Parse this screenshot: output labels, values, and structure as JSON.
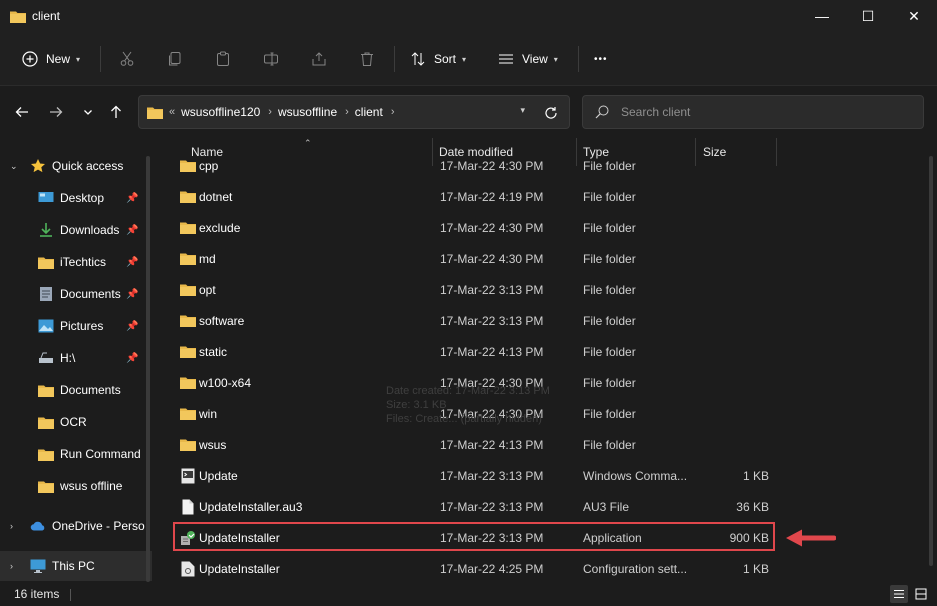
{
  "window": {
    "title": "client",
    "minimize_glyph": "—",
    "maximize_glyph": "☐",
    "close_glyph": "✕"
  },
  "toolbar": {
    "new_label": "New",
    "sort_label": "Sort",
    "view_label": "View",
    "more_glyph": "•••"
  },
  "address": {
    "overflow": "«",
    "crumbs": [
      "wsusoffline120",
      "wsusoffline",
      "client"
    ]
  },
  "search": {
    "placeholder": "Search client"
  },
  "sidebar": {
    "items": [
      {
        "label": "Quick access",
        "icon": "star-icon",
        "pinned": false
      },
      {
        "label": "Desktop",
        "icon": "desktop-icon",
        "pinned": true
      },
      {
        "label": "Downloads",
        "icon": "download-icon",
        "pinned": true
      },
      {
        "label": "iTechtics",
        "icon": "folder-icon",
        "pinned": true
      },
      {
        "label": "Documents",
        "icon": "document-icon",
        "pinned": true
      },
      {
        "label": "Pictures",
        "icon": "pictures-icon",
        "pinned": true
      },
      {
        "label": "H:\\",
        "icon": "drive-icon",
        "pinned": true
      },
      {
        "label": "Documents",
        "icon": "folder-icon",
        "pinned": false
      },
      {
        "label": "OCR",
        "icon": "folder-icon",
        "pinned": false
      },
      {
        "label": "Run Command",
        "icon": "folder-icon",
        "pinned": false
      },
      {
        "label": "wsus offline",
        "icon": "folder-icon",
        "pinned": false
      },
      {
        "label": "OneDrive - Perso",
        "icon": "cloud-icon",
        "pinned": false
      },
      {
        "label": "This PC",
        "icon": "computer-icon",
        "pinned": false
      }
    ]
  },
  "columns": {
    "name": "Name",
    "date": "Date modified",
    "type": "Type",
    "size": "Size"
  },
  "files": [
    {
      "name": "cpp",
      "date": "17-Mar-22 4:30 PM",
      "type": "File folder",
      "size": "",
      "icon": "folder-icon"
    },
    {
      "name": "dotnet",
      "date": "17-Mar-22 4:19 PM",
      "type": "File folder",
      "size": "",
      "icon": "folder-icon"
    },
    {
      "name": "exclude",
      "date": "17-Mar-22 4:30 PM",
      "type": "File folder",
      "size": "",
      "icon": "folder-icon"
    },
    {
      "name": "md",
      "date": "17-Mar-22 4:30 PM",
      "type": "File folder",
      "size": "",
      "icon": "folder-icon"
    },
    {
      "name": "opt",
      "date": "17-Mar-22 3:13 PM",
      "type": "File folder",
      "size": "",
      "icon": "folder-icon"
    },
    {
      "name": "software",
      "date": "17-Mar-22 3:13 PM",
      "type": "File folder",
      "size": "",
      "icon": "folder-icon"
    },
    {
      "name": "static",
      "date": "17-Mar-22 4:13 PM",
      "type": "File folder",
      "size": "",
      "icon": "folder-icon"
    },
    {
      "name": "w100-x64",
      "date": "17-Mar-22 4:30 PM",
      "type": "File folder",
      "size": "",
      "icon": "folder-icon"
    },
    {
      "name": "win",
      "date": "17-Mar-22 4:30 PM",
      "type": "File folder",
      "size": "",
      "icon": "folder-icon"
    },
    {
      "name": "wsus",
      "date": "17-Mar-22 4:13 PM",
      "type": "File folder",
      "size": "",
      "icon": "folder-icon"
    },
    {
      "name": "Update",
      "date": "17-Mar-22 3:13 PM",
      "type": "Windows Comma...",
      "size": "1 KB",
      "icon": "script-icon"
    },
    {
      "name": "UpdateInstaller.au3",
      "date": "17-Mar-22 3:13 PM",
      "type": "AU3 File",
      "size": "36 KB",
      "icon": "file-icon"
    },
    {
      "name": "UpdateInstaller",
      "date": "17-Mar-22 3:13 PM",
      "type": "Application",
      "size": "900 KB",
      "icon": "application-icon"
    },
    {
      "name": "UpdateInstaller",
      "date": "17-Mar-22 4:25 PM",
      "type": "Configuration sett...",
      "size": "1 KB",
      "icon": "settings-file-icon"
    }
  ],
  "tooltip_ghost": {
    "line1": "Date created: 17-Mar-22 3:13 PM",
    "line2": "Size: 3.1 KB",
    "line3": "Files: Create... (partially hidden)"
  },
  "status": {
    "item_count": "16 items"
  },
  "colors": {
    "accent": "#e0474c",
    "folder": "#e8b84a"
  }
}
